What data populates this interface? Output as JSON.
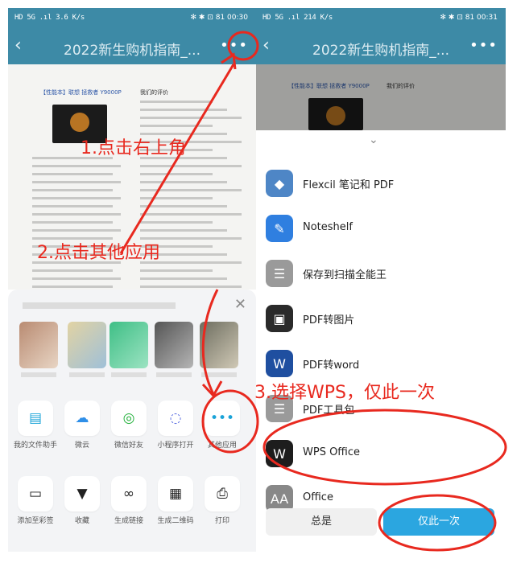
{
  "left": {
    "status": {
      "left": "HD 5G .ıl 3.6 K/s",
      "right": "✻ ✱ ⊡ 81 00:30"
    },
    "title": "2022新生购机指南_...",
    "doc": {
      "heading": "【性能本】联想 拯救者 Y9000P",
      "review": "我们的评价"
    },
    "share_sheet": {
      "apps_row1": [
        {
          "icon": "folder-icon",
          "label": "我的文件助手",
          "color": "#1aa3d8"
        },
        {
          "icon": "cloud-icon",
          "label": "微云",
          "color": "#2f8fe8"
        },
        {
          "icon": "wechat-icon",
          "label": "微信好友",
          "color": "#24b13c"
        },
        {
          "icon": "miniprogram-icon",
          "label": "小程序打开",
          "color": "#5b6ee1"
        },
        {
          "icon": "more-apps-icon",
          "label": "其他应用",
          "color": "#1aa3d8"
        }
      ],
      "apps_row2": [
        {
          "icon": "note-icon",
          "label": "添加至彩签",
          "color": "#222"
        },
        {
          "icon": "bookmark-icon",
          "label": "收藏",
          "color": "#222"
        },
        {
          "icon": "link-icon",
          "label": "生成链接",
          "color": "#222"
        },
        {
          "icon": "qrcode-icon",
          "label": "生成二维码",
          "color": "#222"
        },
        {
          "icon": "print-icon",
          "label": "打印",
          "color": "#222"
        }
      ]
    }
  },
  "right": {
    "status": {
      "left": "HD 5G .ıl 214 K/s",
      "right": "✻ ✱ ⊡ 81 00:31"
    },
    "title": "2022新生购机指南_...",
    "apps": [
      {
        "icon": "flexcil-icon",
        "label": "Flexcil 笔记和 PDF",
        "color": "#4e86c6"
      },
      {
        "icon": "noteshelf-icon",
        "label": "Noteshelf",
        "color": "#2f7fe0"
      },
      {
        "icon": "camscanner-icon",
        "label": "保存到扫描全能王",
        "color": "#9a9a9a"
      },
      {
        "icon": "pdf-image-icon",
        "label": "PDF转图片",
        "color": "#2a2a2a"
      },
      {
        "icon": "pdf-word-icon",
        "label": "PDF转word",
        "color": "#1f4fa0"
      },
      {
        "icon": "pdf-tools-icon",
        "label": "PDF工具包",
        "color": "#9a9a9a"
      },
      {
        "icon": "wps-icon",
        "label": "WPS Office",
        "color": "#1d1d1d"
      },
      {
        "icon": "office-icon",
        "label": "Office",
        "color": "#888888"
      }
    ],
    "always_label": "总是",
    "once_label": "仅此一次"
  },
  "annotations": {
    "step1": "1.点击右上角",
    "step2": "2.点击其他应用",
    "step3": "3.选择WPS，仅此一次"
  }
}
